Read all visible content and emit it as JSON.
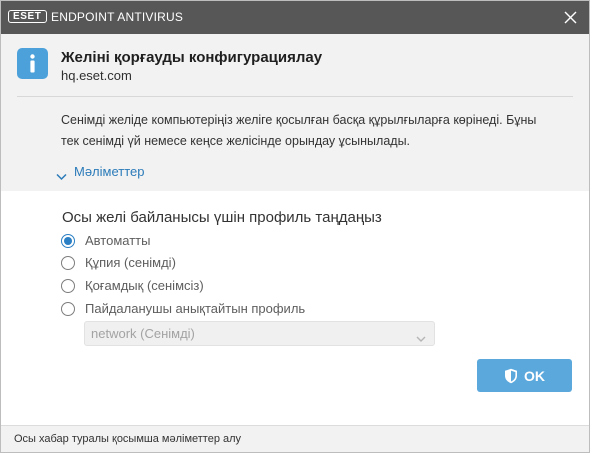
{
  "window": {
    "brand_logo": "eset",
    "product_name": "ENDPOINT ANTIVIRUS",
    "close_icon": "close-icon"
  },
  "header": {
    "icon": "info-icon",
    "title": "Желіні қорғауды конфигурациялау",
    "network_name": "hq.eset.com",
    "description_lines": [
      "Сенімді желіде компьютеріңіз желіге қосылған басқа құрылғыларға көрінеді. Бұны",
      "тек сенімді үй немесе кеңсе желісінде орындау ұсынылады."
    ],
    "details_icon": "chevron-down-icon",
    "details_label": "Мәліметтер"
  },
  "profile": {
    "heading": "Осы желі байланысы үшін профиль таңдаңыз",
    "options": [
      {
        "label": "Автоматты",
        "selected": true
      },
      {
        "label": "Құпия (сенімді)",
        "selected": false
      },
      {
        "label": "Қоғамдық (сенімсіз)",
        "selected": false
      },
      {
        "label": "Пайдаланушы анықтайтын профиль",
        "selected": false
      }
    ],
    "custom_profile_select": {
      "value": "network (Сенімді)",
      "enabled": false,
      "icon": "chevron-down-icon"
    }
  },
  "actions": {
    "ok_icon": "shield-icon",
    "ok_label": "OK"
  },
  "footer": {
    "link_label": "Осы хабар туралы қосымша мәліметтер алу"
  },
  "colors": {
    "title_bar": "#575757",
    "header_background": "#f2f2f2",
    "info_icon": "#4da1da",
    "accent": "#2b7fc4",
    "link": "#2b7bb9",
    "ok_button": "#5ba8dc"
  }
}
